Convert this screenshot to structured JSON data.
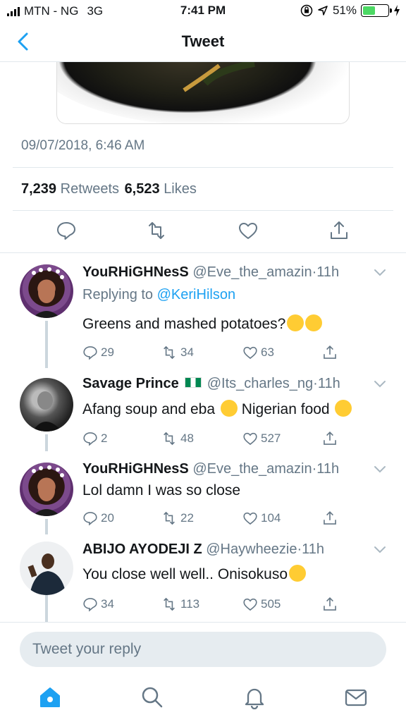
{
  "status_bar": {
    "carrier": "MTN - NG",
    "network": "3G",
    "time": "7:41 PM",
    "battery": "51%",
    "battery_level": 0.51
  },
  "nav": {
    "title": "Tweet"
  },
  "tweet": {
    "timestamp": "09/07/2018, 6:46 AM",
    "retweets_count": "7,239",
    "retweets_label": "Retweets",
    "likes_count": "6,523",
    "likes_label": "Likes"
  },
  "replies": [
    {
      "name": "YouRHiGHNesS",
      "handle": "@Eve_the_amazin",
      "time": "11h",
      "replying_prefix": "Replying to",
      "replying_to": "@KeriHilson",
      "text": "Greens and mashed potatoes?",
      "reply_count": "29",
      "retweet_count": "34",
      "like_count": "63"
    },
    {
      "name": "Savage Prince",
      "handle": "@Its_charles_ng",
      "time": "11h",
      "text_part1": "Afang soup and eba",
      "text_part2": "Nigerian food",
      "reply_count": "2",
      "retweet_count": "48",
      "like_count": "527"
    },
    {
      "name": "YouRHiGHNesS",
      "handle": "@Eve_the_amazin",
      "time": "11h",
      "text": "Lol damn I was so close",
      "reply_count": "20",
      "retweet_count": "22",
      "like_count": "104"
    },
    {
      "name": "ABIJO AYODEJI Z",
      "handle": "@Haywheezie",
      "time": "11h",
      "text": "You close well well.. Onisokuso",
      "reply_count": "34",
      "retweet_count": "113",
      "like_count": "505"
    }
  ],
  "composer": {
    "placeholder": "Tweet your reply"
  },
  "colors": {
    "accent": "#1da1f2",
    "secondary_text": "#657786",
    "divider": "#e1e8ed"
  },
  "icons": [
    "back-chevron-icon",
    "reply-icon",
    "retweet-icon",
    "like-icon",
    "share-icon",
    "home-icon",
    "search-icon",
    "notifications-icon",
    "messages-icon"
  ]
}
